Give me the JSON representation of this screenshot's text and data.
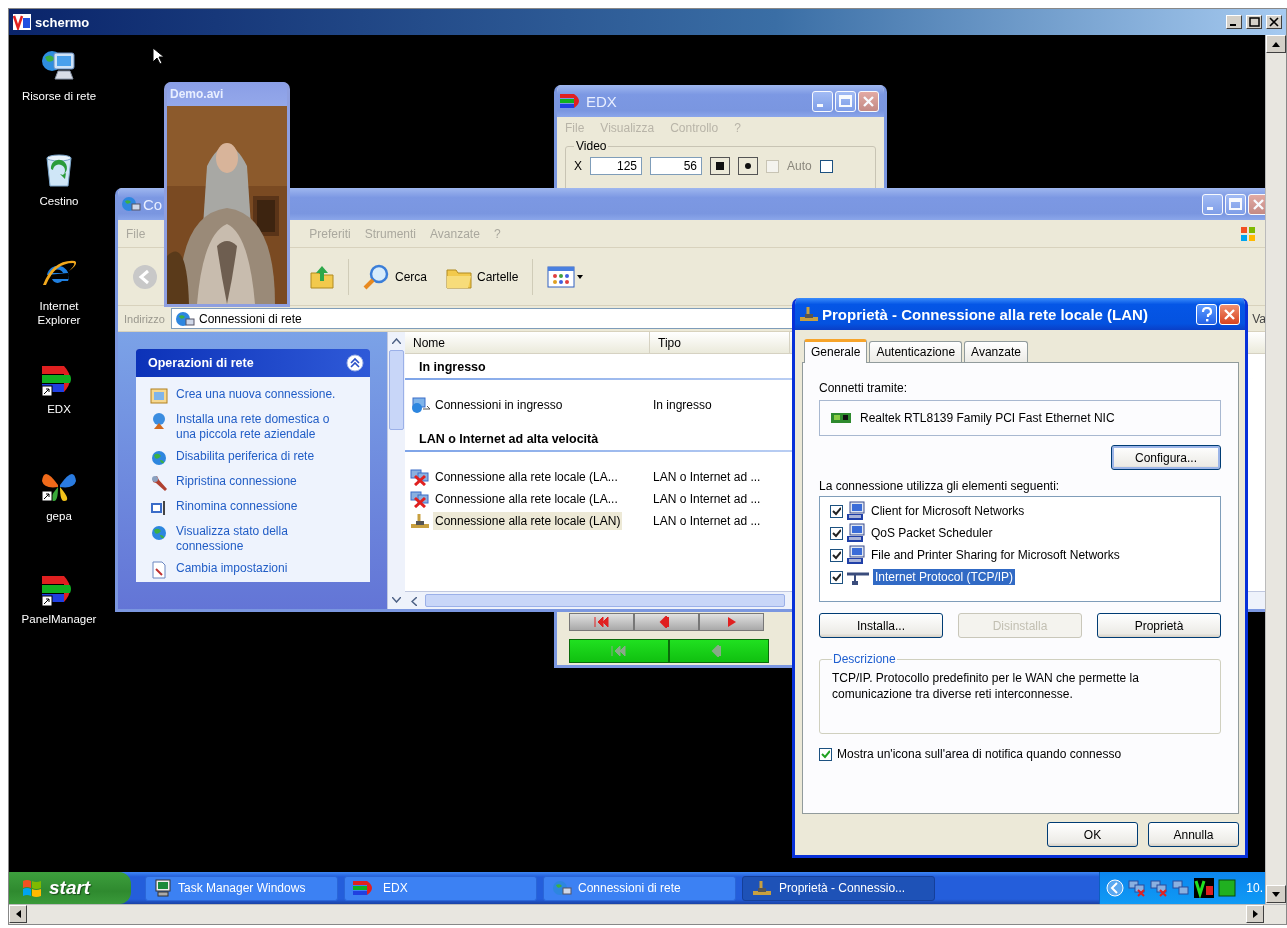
{
  "viewer": {
    "title": "schermo"
  },
  "desktop_icons": [
    {
      "label": "Risorse di rete",
      "kind": "network"
    },
    {
      "label": "Cestino",
      "kind": "bin"
    },
    {
      "label": "Internet Explorer",
      "kind": "browser"
    },
    {
      "label": "EDX",
      "kind": "edx"
    },
    {
      "label": "gepa",
      "kind": "butterfly"
    },
    {
      "label": "PanelManager",
      "kind": "edx"
    }
  ],
  "edx": {
    "title": "EDX",
    "menu": [
      "File",
      "Visualizza",
      "Controllo",
      "?"
    ],
    "group": "Video",
    "x_label": "X",
    "x_value": "125",
    "y_value": "56",
    "checkboxes": [
      {
        "label": "Auto",
        "checked": false,
        "disabled": true
      },
      {
        "checked": false,
        "disabled": false
      }
    ]
  },
  "video_window": {
    "title": "Demo.avi"
  },
  "explorer": {
    "title": "Co",
    "menu": [
      "File",
      "Preferiti",
      "Strumenti",
      "Avanzate",
      "?"
    ],
    "toolbar": [
      {
        "label": "Cerca",
        "kind": "search"
      },
      {
        "label": "Cartelle",
        "kind": "folders"
      }
    ],
    "address_label": "Indirizzo",
    "address": "Connessioni di rete",
    "go": "Va",
    "tasks": {
      "title": "Operazioni di rete",
      "items": [
        {
          "label": "Crea una nuova connessione.",
          "kind": "wizard"
        },
        {
          "label": "Installa una rete domestica o una piccola rete aziendale",
          "kind": "home"
        },
        {
          "label": "Disabilita periferica di rete",
          "kind": "globe"
        },
        {
          "label": "Ripristina connessione",
          "kind": "wrench"
        },
        {
          "label": "Rinomina connessione",
          "kind": "rename"
        },
        {
          "label": "Visualizza stato della connessione",
          "kind": "globe"
        },
        {
          "label": "Cambia impostazioni",
          "kind": "settings"
        }
      ]
    },
    "columns": [
      "Nome",
      "Tipo"
    ],
    "groups": [
      {
        "title": "In ingresso",
        "rows": [
          {
            "name": "Connessioni in ingresso",
            "type": "In ingresso",
            "kind": "incoming",
            "selected": false
          }
        ]
      },
      {
        "title": "LAN o Internet ad alta velocità",
        "rows": [
          {
            "name": "Connessione alla rete locale (LA...",
            "type": "LAN o Internet ad ...",
            "kind": "lan_off",
            "selected": false
          },
          {
            "name": "Connessione alla rete locale (LA...",
            "type": "LAN o Internet ad ...",
            "kind": "lan_off",
            "selected": false
          },
          {
            "name": "Connessione alla rete locale (LAN)",
            "type": "LAN o Internet ad ...",
            "kind": "lan",
            "selected": true
          }
        ]
      }
    ]
  },
  "dialog": {
    "title": "Proprietà - Connessione alla rete locale (LAN)",
    "tabs": [
      {
        "label": "Generale",
        "selected": true
      },
      {
        "label": "Autenticazione",
        "selected": false
      },
      {
        "label": "Avanzate",
        "selected": false
      }
    ],
    "connect_label": "Connetti tramite:",
    "adapter": "Realtek RTL8139 Family PCI Fast Ethernet NIC",
    "configure": "Configura...",
    "components_label": "La connessione utilizza gli elementi seguenti:",
    "components": [
      {
        "label": "Client for Microsoft Networks",
        "kind": "computer",
        "checked": true,
        "selected": false
      },
      {
        "label": "QoS Packet Scheduler",
        "kind": "computer",
        "checked": true,
        "selected": false
      },
      {
        "label": "File and Printer Sharing for Microsoft Networks",
        "kind": "computer",
        "checked": true,
        "selected": false
      },
      {
        "label": "Internet Protocol (TCP/IP)",
        "kind": "protocol",
        "checked": true,
        "selected": true
      }
    ],
    "buttons": [
      {
        "label": "Installa...",
        "disabled": false
      },
      {
        "label": "Disinstalla",
        "disabled": true
      },
      {
        "label": "Proprietà",
        "disabled": false
      }
    ],
    "description_title": "Descrizione",
    "description": "TCP/IP. Protocollo predefinito per le WAN che permette la comunicazione tra diverse reti interconnesse.",
    "notify": {
      "label": "Mostra un'icona sull'area di notifica quando connesso",
      "checked": true
    },
    "footer_buttons": [
      "OK",
      "Annulla"
    ]
  },
  "taskbar": {
    "start": "start",
    "buttons": [
      {
        "label": "Task Manager Windows",
        "kind": "taskmgr",
        "selected": false
      },
      {
        "label": "EDX",
        "kind": "edx",
        "selected": false
      },
      {
        "label": "Connessioni di rete",
        "kind": "network",
        "selected": false
      },
      {
        "label": "Proprietà - Connessio...",
        "kind": "lan",
        "selected": true
      }
    ],
    "clock": "10."
  }
}
